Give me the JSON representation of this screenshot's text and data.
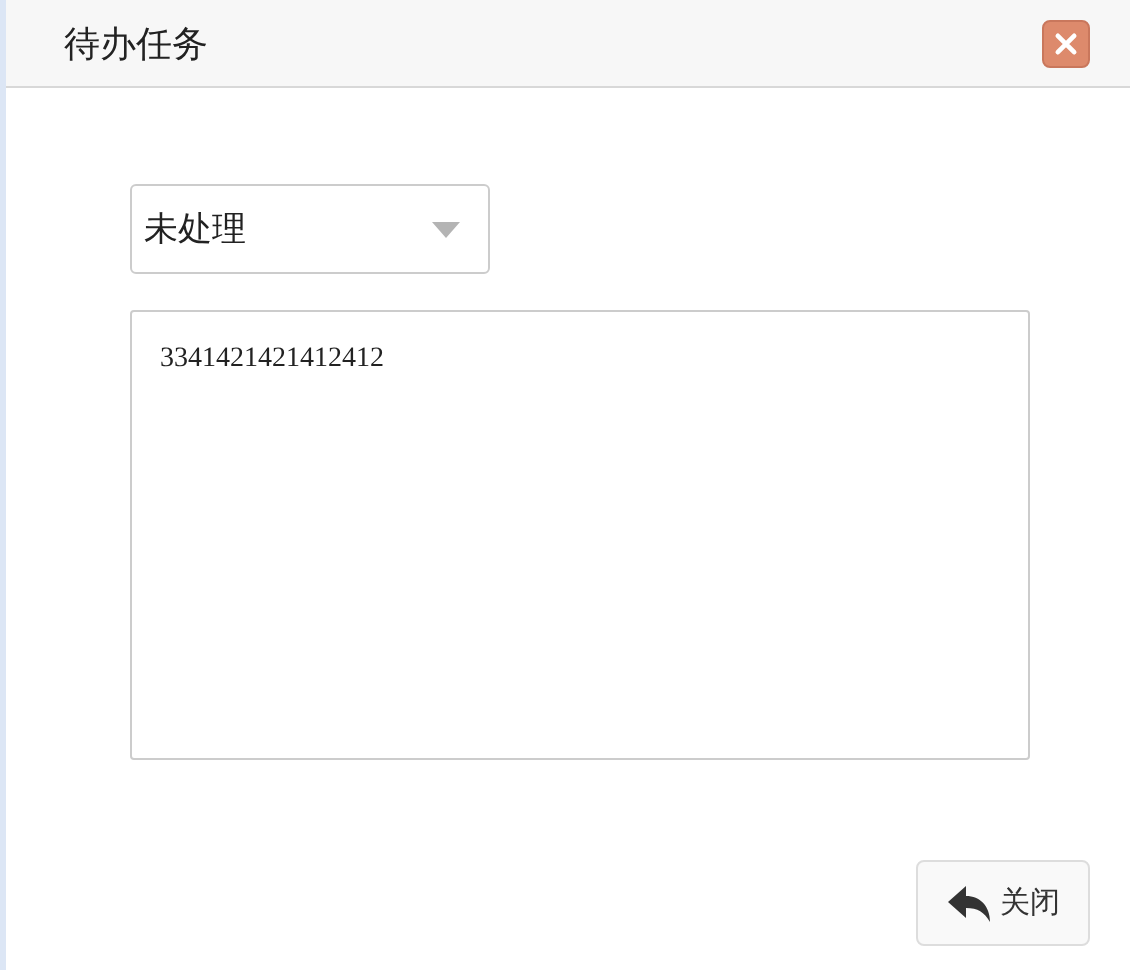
{
  "window": {
    "title": "待办任务"
  },
  "status_select": {
    "value": "未处理"
  },
  "content": {
    "value": "3341421421412412"
  },
  "buttons": [
    {
      "kind": "close",
      "label": "关闭"
    }
  ]
}
